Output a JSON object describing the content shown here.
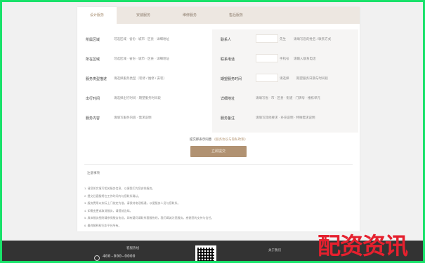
{
  "tabs": [
    {
      "label": "设计服务",
      "active": true
    },
    {
      "label": "安装服务",
      "active": false
    },
    {
      "label": "维修服务",
      "active": false
    },
    {
      "label": "售后服务",
      "active": false
    }
  ],
  "form_left": [
    {
      "label": "所属区域",
      "value": "可选区域 · 省份 · 城市 · 区县 · 详细地址"
    },
    {
      "label": "所在区域",
      "value": "可选区域 · 省份 · 城市 · 区县 · 详细地址"
    },
    {
      "label": "服务类型描述",
      "value": "请选择服务类型（装修 / 维修 / 安装）"
    },
    {
      "label": "出行时间",
      "value": "请选择出行时间 · 期望服务时间段"
    },
    {
      "label": "服务内容",
      "value": "请填写服务内容 · 需求说明"
    }
  ],
  "form_right": [
    {
      "label": "联系人",
      "value": "先生",
      "after": "请填写您的姓名 / 联系方式"
    },
    {
      "label": "联系电话",
      "value": "手机号",
      "after": "请输入联系电话"
    },
    {
      "label": "期望服务时间",
      "value": "请选择",
      "after": "期望服务日期与时间段"
    },
    {
      "label": "详细地址",
      "value": "请填写省 · 市 · 区县 · 街道 · 门牌号 · 楼栋单元"
    },
    {
      "label": "服务备注",
      "value": "请填写其他要求 · 补充说明 · 特殊需求说明"
    }
  ],
  "agreement": {
    "prefix": "提交即表示同意",
    "link": "《服务协议与隐私政策》"
  },
  "submit_label": "立即提交",
  "notes_title": "注意事项",
  "notes": [
    "1. 请您如实填写相关服务信息，以便我们为您安排服务。",
    "2. 提交后客服将在工作时间内与您联系确认。",
    "3. 服务费用以实际上门核定为准，请保持电话畅通，以便服务人员与您联系。",
    "4. 如需变更或取消服务，请提前告知。",
    "5. 具体服务细则请参阅服务协议，如有疑问请联系客服热线，我们竭诚为您服务，感谢您的支持与信任。",
    "6. 最终解释权归本平台所有。"
  ],
  "footer": {
    "text1": "客服热线",
    "phone": "400-000-0000",
    "about": "关于我们"
  },
  "watermark": "配资资讯",
  "colors": {
    "accent": "#b19272",
    "border": "#19e26a",
    "watermark": "#e5202e",
    "footer_bg": "#333333"
  }
}
